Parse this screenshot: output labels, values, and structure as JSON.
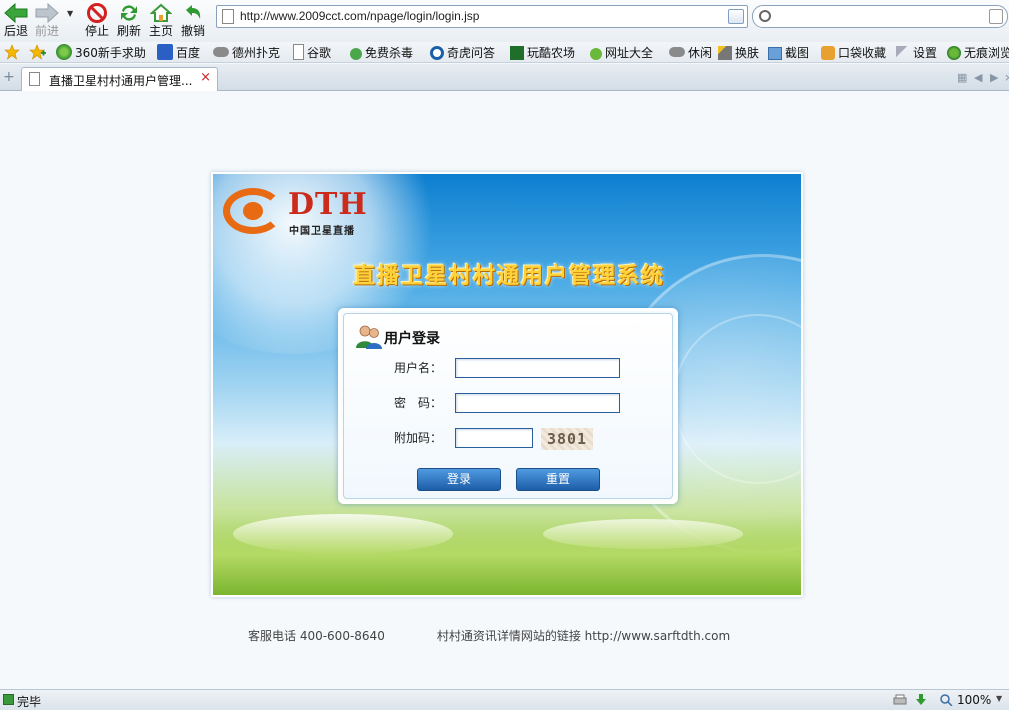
{
  "toolbar": {
    "back": "后退",
    "forward": "前进",
    "stop": "停止",
    "refresh": "刷新",
    "home": "主页",
    "undo": "撤销"
  },
  "address": {
    "url": "http://www.2009cct.com/npage/login/login.jsp"
  },
  "favorites": [
    {
      "label": "360新手求助",
      "icon": "ie-icon"
    },
    {
      "label": "百度",
      "icon": "baidu-icon"
    },
    {
      "label": "德州扑克",
      "icon": "gamepad-icon"
    },
    {
      "label": "谷歌",
      "icon": "page-icon"
    },
    {
      "label": "免费杀毒",
      "icon": "antivirus-icon"
    },
    {
      "label": "奇虎问答",
      "icon": "qihoo-icon"
    },
    {
      "label": "玩酷农场",
      "icon": "me-icon"
    },
    {
      "label": "网址大全",
      "icon": "plus-icon"
    },
    {
      "label": "休闲",
      "icon": "gamepad-icon"
    },
    {
      "label": "换肤",
      "icon": "wand-icon"
    },
    {
      "label": "截图",
      "icon": "screenshot-icon"
    },
    {
      "label": "口袋收藏",
      "icon": "pocket-icon"
    },
    {
      "label": "设置",
      "icon": "wrench-icon"
    },
    {
      "label": "无痕浏览",
      "icon": "incognito-icon"
    }
  ],
  "tab": {
    "title": "直播卫星村村通用户管理..."
  },
  "login_page": {
    "logo_brand": "DTH",
    "logo_sub": "中国卫星直播",
    "system_title": "直播卫星村村通用户管理系统",
    "box_title": "用户登录",
    "username_label": "用户名：",
    "password_label": "密　码：",
    "captcha_label": "附加码：",
    "captcha_value": "3801",
    "login_button": "登录",
    "reset_button": "重置"
  },
  "footer": {
    "hotline": "客服电话  400-600-8640",
    "link_text": "村村通资讯详情网站的链接  http://www.sarftdth.com"
  },
  "status": {
    "text": "完毕",
    "zoom": "100%"
  },
  "colors": {
    "brand_red": "#cc2a1a",
    "logo_orange": "#e86a12",
    "title_gold": "#ffd23a",
    "button_blue": "#1d5ea8"
  }
}
